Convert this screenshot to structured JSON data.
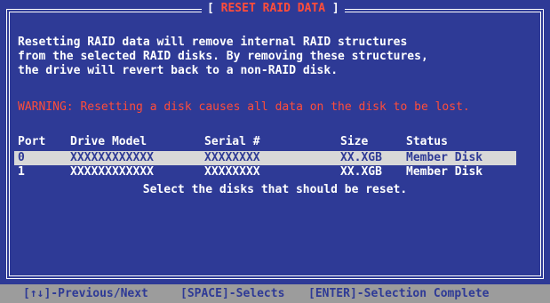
{
  "title": "RESET RAID DATA",
  "description_lines": [
    "Resetting RAID data will remove internal RAID structures",
    "from the selected RAID disks. By removing these structures,",
    "the drive will revert back to a non-RAID disk."
  ],
  "warning": "WARNING: Resetting a disk causes all data on the disk to be lost.",
  "table": {
    "headers": {
      "port": "Port",
      "drive_model": "Drive Model",
      "serial": "Serial #",
      "size": "Size",
      "status": "Status"
    },
    "rows": [
      {
        "port": "0",
        "drive_model": "XXXXXXXXXXXX",
        "serial": "XXXXXXXX",
        "size": "XX.XGB",
        "status": "Member Disk"
      },
      {
        "port": "1",
        "drive_model": "XXXXXXXXXXXX",
        "serial": "XXXXXXXX",
        "size": "XX.XGB",
        "status": "Member Disk"
      }
    ]
  },
  "instruction": "Select the disks that should be reset.",
  "footer": {
    "nav": "[↑↓]-Previous/Next",
    "select": "[SPACE]-Selects",
    "complete": "[ENTER]-Selection Complete"
  },
  "colors": {
    "background": "#2e3a96",
    "warning": "#ff4d3a",
    "selected_row": "#d8d8d8",
    "footer": "#9c9c9c"
  }
}
